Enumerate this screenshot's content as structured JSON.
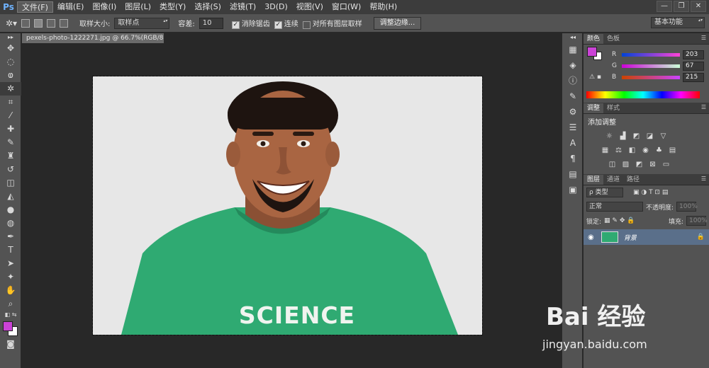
{
  "app": {
    "logo": "Ps"
  },
  "menu": [
    "文件(F)",
    "编辑(E)",
    "图像(I)",
    "图层(L)",
    "类型(Y)",
    "选择(S)",
    "滤镜(T)",
    "3D(D)",
    "视图(V)",
    "窗口(W)",
    "帮助(H)"
  ],
  "window_controls": {
    "minimize": "—",
    "restore": "❐",
    "close": "✕"
  },
  "options": {
    "sample_size_label": "取样大小:",
    "sample_size_value": "取样点",
    "tolerance_label": "容差:",
    "tolerance_value": "10",
    "antialias_label": "消除锯齿",
    "contiguous_label": "连续",
    "all_layers_label": "对所有图层取样",
    "refine_edge_label": "调整边缘...",
    "workspace_value": "基本功能"
  },
  "document": {
    "tab_title": "pexels-photo-1222271.jpg @ 66.7%(RGB/8) *",
    "tab_close": "×"
  },
  "photo": {
    "shirt_text": "SCIENCE"
  },
  "color_panel": {
    "tabs": [
      "颜色",
      "色板"
    ],
    "r_label": "R",
    "r_value": "203",
    "g_label": "G",
    "g_value": "67",
    "b_label": "B",
    "b_value": "215",
    "foreground": "#cb43d7"
  },
  "adjust_panel": {
    "tabs": [
      "调整",
      "样式"
    ],
    "add_label": "添加调整"
  },
  "layers_panel": {
    "tabs": [
      "图层",
      "通道",
      "路径"
    ],
    "filter_label": "ρ 类型",
    "blend_mode": "正常",
    "opacity_label": "不透明度:",
    "opacity_value": "100%",
    "lock_label": "锁定:",
    "fill_label": "填充:",
    "fill_value": "100%",
    "layer_name": "背景"
  },
  "watermark": {
    "brand": "Bai 经验",
    "url": "jingyan.baidu.com"
  }
}
